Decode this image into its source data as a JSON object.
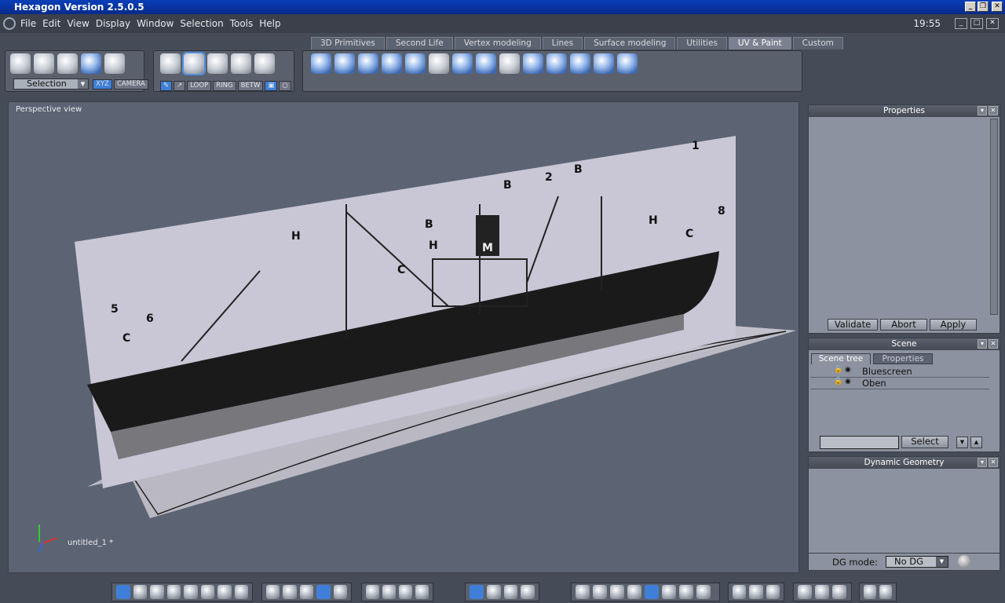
{
  "window": {
    "title": "Hexagon Version 2.5.0.5",
    "clock": "19:55"
  },
  "menu": [
    "File",
    "Edit",
    "View",
    "Display",
    "Window",
    "Selection",
    "Tools",
    "Help"
  ],
  "tabs": [
    {
      "label": "3D Primitives"
    },
    {
      "label": "Second Life"
    },
    {
      "label": "Vertex modeling"
    },
    {
      "label": "Lines"
    },
    {
      "label": "Surface modeling"
    },
    {
      "label": "Utilities"
    },
    {
      "label": "UV & Paint",
      "active": true
    },
    {
      "label": "Custom"
    }
  ],
  "toolbar": {
    "selection_mode": "Selection",
    "xyz": "XYZ",
    "camera": "CAMERA",
    "loop": "LOOP",
    "ring": "RING",
    "betw": "BETW"
  },
  "viewport": {
    "label": "Perspective view",
    "document": "untitled_1 *"
  },
  "properties": {
    "title": "Properties",
    "validate": "Validate",
    "abort": "Abort",
    "apply": "Apply"
  },
  "scene": {
    "title": "Scene",
    "tabs": [
      "Scene tree",
      "Properties"
    ],
    "items": [
      "Bluescreen",
      "Oben"
    ],
    "search_value": "",
    "select": "Select"
  },
  "dynamic_geometry": {
    "title": "Dynamic Geometry",
    "mode_label": "DG mode:",
    "mode_value": "No DG"
  },
  "colors": {
    "titlebar": "#0a3fb8",
    "accent": "#3f7fd8",
    "viewport_bg": "#5c6473"
  }
}
